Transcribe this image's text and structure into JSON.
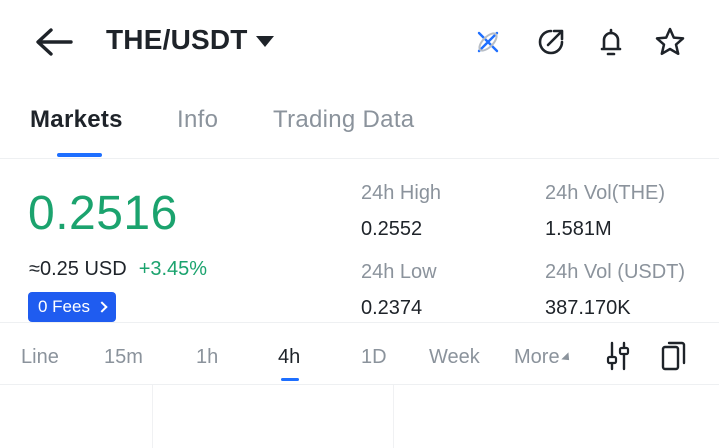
{
  "header": {
    "pair_title": "THE/USDT"
  },
  "tabs": [
    {
      "label": "Markets"
    },
    {
      "label": "Info"
    },
    {
      "label": "Trading Data"
    }
  ],
  "price": {
    "last": "0.2516",
    "approx": "≈0.25 USD",
    "change": "+3.45%",
    "fees_badge": "0 Fees"
  },
  "stats": {
    "high_label": "24h High",
    "high_value": "0.2552",
    "low_label": "24h Low",
    "low_value": "0.2374",
    "vol_base_label": "24h Vol(THE)",
    "vol_base_value": "1.581M",
    "vol_quote_label": "24h Vol (USDT)",
    "vol_quote_value": "387.170K"
  },
  "intervals": [
    {
      "label": "Line"
    },
    {
      "label": "15m"
    },
    {
      "label": "1h"
    },
    {
      "label": "4h"
    },
    {
      "label": "1D"
    },
    {
      "label": "Week"
    },
    {
      "label": "More"
    }
  ],
  "colors": {
    "up": "#1ba36e",
    "accent": "#1e6fff",
    "fees_bg": "#1f5cf0"
  },
  "icons": {
    "back": "arrow-left-icon",
    "logo": "x-logo-icon",
    "share": "share-icon",
    "alert": "bell-icon",
    "favorite": "star-icon",
    "indicator": "sliders-icon",
    "copy": "copy-icon"
  }
}
